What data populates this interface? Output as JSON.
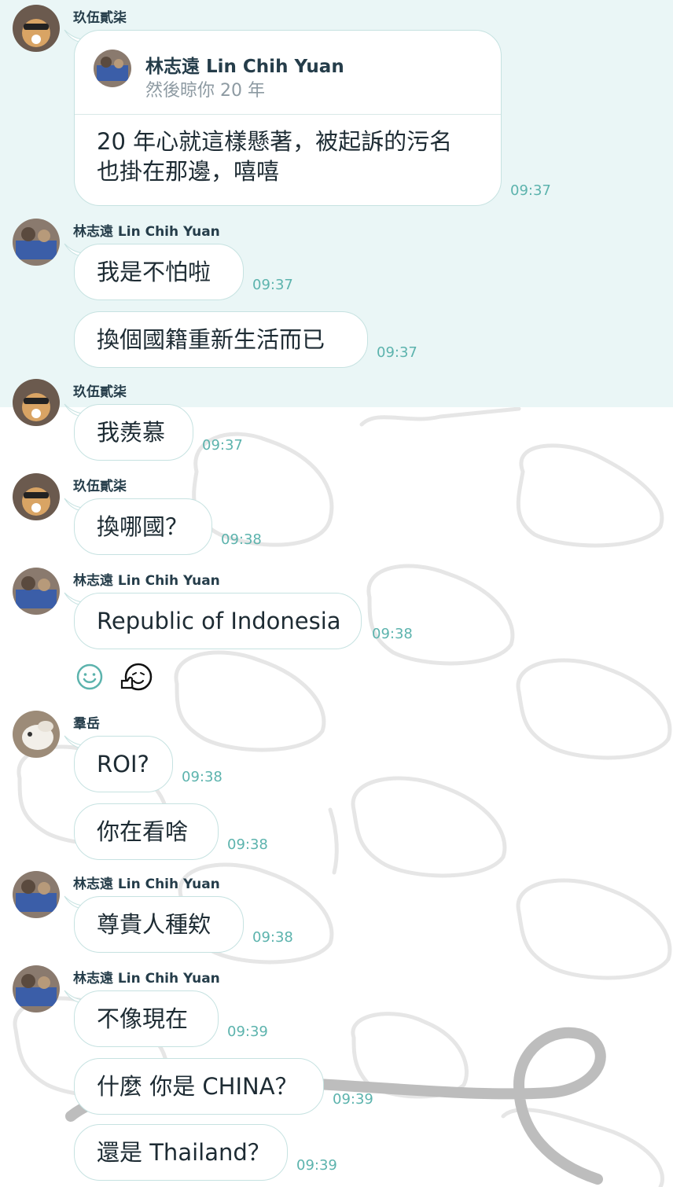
{
  "colors": {
    "accent": "#5cb3ad",
    "highlight_bg": "#eaf6f6",
    "bubble_border": "#c6e2e1",
    "text": "#1d2b33"
  },
  "icons": {
    "add_reaction": "smile-outline-icon",
    "reaction_sticker": "thumbs-up-face-sticker-icon"
  },
  "quote": {
    "sender": "玖伍貳柒",
    "quoted_name": "林志遠 Lin Chih Yuan",
    "quoted_text": "然後晾你 20 年",
    "body_line1": "20 年心就這樣懸著，被起訴的污名",
    "body_line2": "也掛在那邊，嘻嘻",
    "time": "09:37"
  },
  "messages": [
    {
      "sender": "林志遠 Lin Chih Yuan",
      "text": "我是不怕啦",
      "time": "09:37"
    },
    {
      "text": "換個國籍重新生活而已",
      "time": "09:37"
    },
    {
      "sender": "玖伍貳柒",
      "text": "我羨慕",
      "time": "09:37"
    },
    {
      "sender": "玖伍貳柒",
      "text": "換哪國？",
      "time": "09:38"
    },
    {
      "sender": "林志遠 Lin Chih Yuan",
      "text": "Republic of Indonesia",
      "time": "09:38"
    },
    {
      "sender": "羣岳",
      "text": "ROI?",
      "time": "09:38"
    },
    {
      "text": "你在看啥",
      "time": "09:38"
    },
    {
      "sender": "林志遠 Lin Chih Yuan",
      "text": "尊貴人種欸",
      "time": "09:38"
    },
    {
      "sender": "林志遠 Lin Chih Yuan",
      "text": "不像現在",
      "time": "09:39"
    },
    {
      "text": "什麼 你是 CHINA？",
      "time": "09:39"
    },
    {
      "text": "還是 Thailand？",
      "time": "09:39"
    }
  ]
}
